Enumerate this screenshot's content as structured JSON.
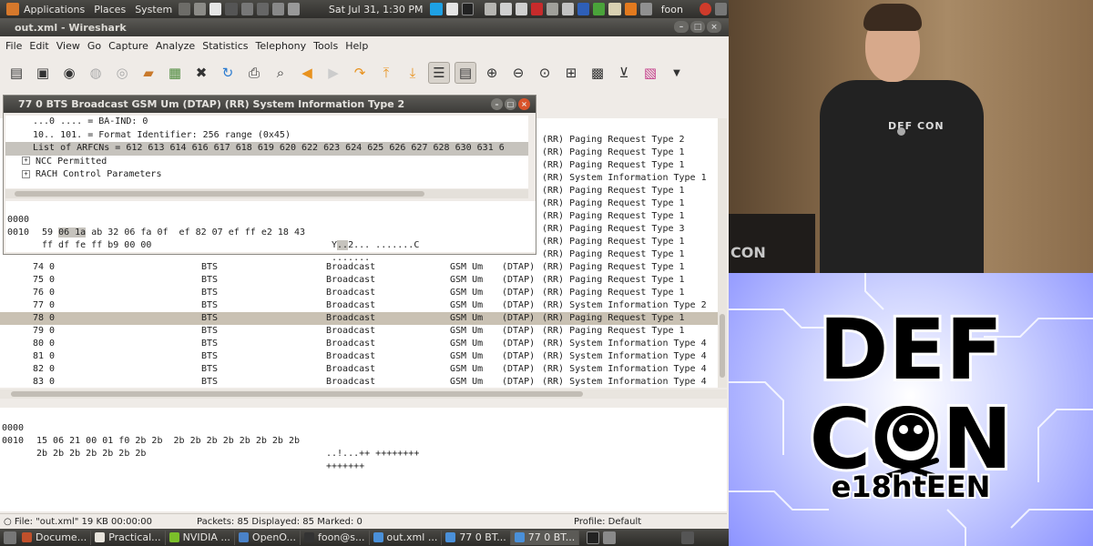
{
  "top_panel": {
    "menus": [
      "Applications",
      "Places",
      "System"
    ],
    "clock": "Sat Jul 31,  1:30 PM",
    "user": "foon"
  },
  "window": {
    "title": "out.xml - Wireshark"
  },
  "menubar": [
    "File",
    "Edit",
    "View",
    "Go",
    "Capture",
    "Analyze",
    "Statistics",
    "Telephony",
    "Tools",
    "Help"
  ],
  "toolbar_icons": [
    "interface-list-icon",
    "capture-options-icon",
    "start-capture-icon",
    "stop-capture-icon",
    "restart-capture-icon",
    "open-icon",
    "save-icon",
    "close-icon",
    "reload-icon",
    "print-icon",
    "find-icon",
    "back-icon",
    "forward-icon",
    "go-to-icon",
    "first-packet-icon",
    "last-packet-icon",
    "colorize-icon",
    "autoscroll-icon",
    "zoom-in-icon",
    "zoom-out-icon",
    "normal-size-icon",
    "resize-columns-icon",
    "capture-filters-icon",
    "display-filters-icon",
    "coloring-rules-icon",
    "more-icon"
  ],
  "popup": {
    "title": "77 0 BTS Broadcast GSM Um (DTAP) (RR) System Information Type 2",
    "detail_lines": [
      {
        "text": "...0 .... = BA-IND: 0",
        "kind": "plain"
      },
      {
        "text": "10.. 101. = Format Identifier: 256 range (0x45)",
        "kind": "plain"
      },
      {
        "text": "List of ARFCNs = 612 613 614 616 617 618 619 620 622 623 624 625 626 627 628 630 631 6",
        "kind": "hl"
      },
      {
        "text": "NCC Permitted",
        "kind": "tree"
      },
      {
        "text": "RACH Control Parameters",
        "kind": "tree"
      }
    ],
    "hex": [
      {
        "offset": "0000",
        "pre": "59 ",
        "sel": "06 1a",
        "post": " ab 32 06 fa 0f  ef 82 07 ef ff e2 18 43",
        "ascii_pre": "Y",
        "ascii_sel": "..",
        "ascii_post": "2... .......C"
      },
      {
        "offset": "0010",
        "pre": "ff df fe ff b9 00 00",
        "sel": "",
        "post": "",
        "ascii_pre": ".......",
        "ascii_sel": "",
        "ascii_post": ""
      }
    ]
  },
  "packets": [
    {
      "no": "",
      "src": "",
      "dst": "",
      "proto": "",
      "info": "(RR) Paging Request Type 2",
      "full": false
    },
    {
      "no": "",
      "src": "",
      "dst": "",
      "proto": "",
      "info": "(RR) Paging Request Type 1",
      "full": false
    },
    {
      "no": "",
      "src": "",
      "dst": "",
      "proto": "",
      "info": "(RR) Paging Request Type 1",
      "full": false
    },
    {
      "no": "",
      "src": "",
      "dst": "",
      "proto": "",
      "info": "(RR) System Information Type 1",
      "full": false
    },
    {
      "no": "",
      "src": "",
      "dst": "",
      "proto": "",
      "info": "(RR) Paging Request Type 1",
      "full": false
    },
    {
      "no": "",
      "src": "",
      "dst": "",
      "proto": "",
      "info": "(RR) Paging Request Type 1",
      "full": false
    },
    {
      "no": "",
      "src": "",
      "dst": "",
      "proto": "",
      "info": "(RR) Paging Request Type 1",
      "full": false
    },
    {
      "no": "",
      "src": "",
      "dst": "",
      "proto": "",
      "info": "(RR) Paging Request Type 3",
      "full": false
    },
    {
      "no": "",
      "src": "",
      "dst": "",
      "proto": "",
      "info": "(RR) Paging Request Type 1",
      "full": false
    },
    {
      "no": "",
      "src": "",
      "dst": "",
      "proto": "",
      "info": "(RR) Paging Request Type 1",
      "full": false
    },
    {
      "no": "74 0",
      "src": "BTS",
      "dst": "Broadcast",
      "proto": "GSM Um",
      "dtap": "(DTAP)",
      "info": "(RR) Paging Request Type 1",
      "full": true
    },
    {
      "no": "75 0",
      "src": "BTS",
      "dst": "Broadcast",
      "proto": "GSM Um",
      "dtap": "(DTAP)",
      "info": "(RR) Paging Request Type 1",
      "full": true
    },
    {
      "no": "76 0",
      "src": "BTS",
      "dst": "Broadcast",
      "proto": "GSM Um",
      "dtap": "(DTAP)",
      "info": "(RR) Paging Request Type 1",
      "full": true
    },
    {
      "no": "77 0",
      "src": "BTS",
      "dst": "Broadcast",
      "proto": "GSM Um",
      "dtap": "(DTAP)",
      "info": "(RR) System Information Type 2",
      "full": true
    },
    {
      "no": "78 0",
      "src": "BTS",
      "dst": "Broadcast",
      "proto": "GSM Um",
      "dtap": "(DTAP)",
      "info": "(RR) Paging Request Type 1",
      "full": true,
      "selected": true
    },
    {
      "no": "79 0",
      "src": "BTS",
      "dst": "Broadcast",
      "proto": "GSM Um",
      "dtap": "(DTAP)",
      "info": "(RR) Paging Request Type 1",
      "full": true
    },
    {
      "no": "80 0",
      "src": "BTS",
      "dst": "Broadcast",
      "proto": "GSM Um",
      "dtap": "(DTAP)",
      "info": "(RR) System Information Type 4",
      "full": true
    },
    {
      "no": "81 0",
      "src": "BTS",
      "dst": "Broadcast",
      "proto": "GSM Um",
      "dtap": "(DTAP)",
      "info": "(RR) System Information Type 4",
      "full": true
    },
    {
      "no": "82 0",
      "src": "BTS",
      "dst": "Broadcast",
      "proto": "GSM Um",
      "dtap": "(DTAP)",
      "info": "(RR) System Information Type 4",
      "full": true
    },
    {
      "no": "83 0",
      "src": "BTS",
      "dst": "Broadcast",
      "proto": "GSM Um",
      "dtap": "(DTAP)",
      "info": "(RR) System Information Type 4",
      "full": true
    }
  ],
  "bottom_hex": [
    {
      "offset": "0000",
      "bytes": "15 06 21 00 01 f0 2b 2b  2b 2b 2b 2b 2b 2b 2b 2b",
      "ascii": "..!...++ ++++++++"
    },
    {
      "offset": "0010",
      "bytes": "2b 2b 2b 2b 2b 2b 2b",
      "ascii": "+++++++"
    }
  ],
  "statusbar": {
    "file": "File: \"out.xml\" 19 KB 00:00:00",
    "packets": "Packets: 85 Displayed: 85 Marked: 0",
    "profile": "Profile: Default"
  },
  "taskbar": [
    {
      "label": "Docume...",
      "color": "#c0502b"
    },
    {
      "label": "Practical...",
      "color": "#e8e4dc"
    },
    {
      "label": "NVIDIA ...",
      "color": "#7bbf2a"
    },
    {
      "label": "OpenO...",
      "color": "#4a82c8"
    },
    {
      "label": "foon@s...",
      "color": "#333333"
    },
    {
      "label": "out.xml ...",
      "color": "#4a90d9"
    },
    {
      "label": "77 0 BT...",
      "color": "#4a90d9"
    },
    {
      "label": "77 0 BT...",
      "color": "#4a90d9",
      "active": true
    }
  ],
  "video": {
    "shirt_logo": "DEF CON",
    "podium_sign": "CON",
    "logo_line1": "DEF",
    "logo_line2": "CON",
    "logo_tagline": "e18htEEN"
  }
}
